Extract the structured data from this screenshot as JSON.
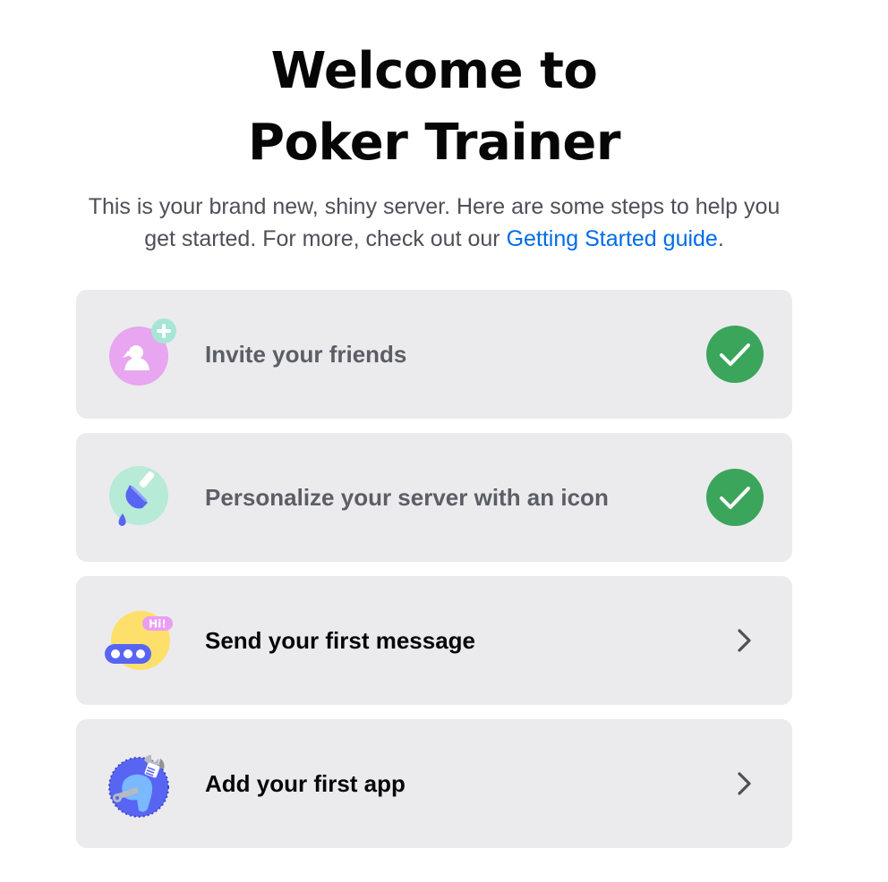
{
  "header": {
    "title_line1": "Welcome to",
    "title_line2": "Poker Trainer",
    "subtitle_text": "This is your brand new, shiny server. Here are some steps to help you get started. For more, check out our ",
    "subtitle_link": "Getting Started guide",
    "subtitle_end": "."
  },
  "colors": {
    "link": "#006ce7",
    "card_bg": "#ebebed",
    "check_green": "#3ba55c",
    "done_text": "#5c5e66",
    "todo_text": "#060607"
  },
  "steps": [
    {
      "label": "Invite your friends",
      "status": "complete",
      "icon": "invite-friends-icon"
    },
    {
      "label": "Personalize your server with an icon",
      "status": "complete",
      "icon": "paintbrush-icon"
    },
    {
      "label": "Send your first message",
      "status": "incomplete",
      "icon": "chat-bubble-icon"
    },
    {
      "label": "Add your first app",
      "status": "incomplete",
      "icon": "wrench-app-icon"
    }
  ]
}
